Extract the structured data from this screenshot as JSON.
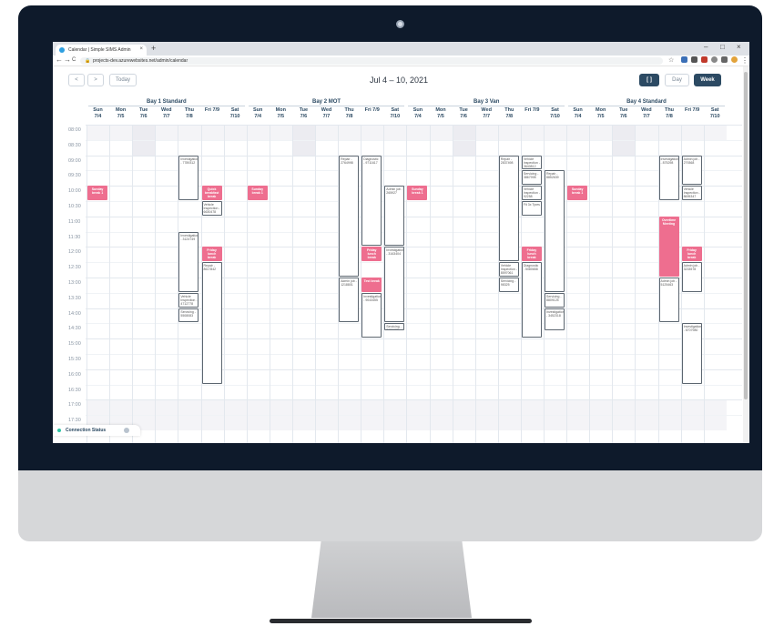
{
  "browser": {
    "tab_title": "Calendar | Simple SIMS Admin",
    "url": "projects-dev.azurewebsites.net/admin/calendar",
    "new_tab": "+",
    "minimize": "–",
    "maximize": "□",
    "close": "×",
    "tab_close": "×",
    "back": "←",
    "forward": "→",
    "reload": "C",
    "star": "☆",
    "menu": "⋮"
  },
  "toolbar": {
    "prev": "<",
    "next": ">",
    "today": "Today",
    "title": "Jul 4 – 10, 2021",
    "fullscreen": "[ ]",
    "day": "Day",
    "week": "Week"
  },
  "bays": [
    "Bay 1 Standard",
    "Bay 2 MOT",
    "Bay 3 Van",
    "Bay 4 Standard"
  ],
  "days": [
    {
      "name": "Sun",
      "date": "7/4"
    },
    {
      "name": "Mon",
      "date": "7/5"
    },
    {
      "name": "Tue",
      "date": "7/6"
    },
    {
      "name": "Wed",
      "date": "7/7"
    },
    {
      "name": "Thu",
      "date": "7/8"
    },
    {
      "name": "Fri 7/9",
      "date": ""
    },
    {
      "name": "Sat",
      "date": "7/10"
    }
  ],
  "times": [
    "08:00",
    "08:30",
    "09:00",
    "09:30",
    "10:00",
    "10:30",
    "11:00",
    "11:30",
    "12:00",
    "12:30",
    "13:00",
    "13:30",
    "14:00",
    "14:30",
    "15:00",
    "15:30",
    "16:00",
    "16:30",
    "17:00",
    "17:30"
  ],
  "events": [
    {
      "bay": 0,
      "day": 0,
      "start": 10.0,
      "end": 10.5,
      "label": "Sunday break 1",
      "pink": true
    },
    {
      "bay": 0,
      "day": 4,
      "start": 9.0,
      "end": 10.5,
      "label": "Investigation - 7789312",
      "pink": false
    },
    {
      "bay": 0,
      "day": 5,
      "start": 10.0,
      "end": 10.5,
      "label": "Quick breakfast break",
      "pink": true
    },
    {
      "bay": 0,
      "day": 5,
      "start": 10.5,
      "end": 11.0,
      "label": "Vehicle Inspection - 6630478",
      "pink": false
    },
    {
      "bay": 0,
      "day": 4,
      "start": 11.5,
      "end": 13.5,
      "label": "Investigation - 3124749",
      "pink": false
    },
    {
      "bay": 0,
      "day": 5,
      "start": 12.0,
      "end": 12.5,
      "label": "Friday lunch break",
      "pink": true
    },
    {
      "bay": 0,
      "day": 5,
      "start": 12.5,
      "end": 16.5,
      "label": "Repair - 8617842",
      "pink": false
    },
    {
      "bay": 0,
      "day": 4,
      "start": 13.5,
      "end": 14.0,
      "label": "Vehicle Inspection - 4712778",
      "pink": false
    },
    {
      "bay": 0,
      "day": 4,
      "start": 14.0,
      "end": 14.5,
      "label": "Servicing - 5508083",
      "pink": false
    },
    {
      "bay": 1,
      "day": 0,
      "start": 10.0,
      "end": 10.5,
      "label": "Sunday break 1",
      "pink": true
    },
    {
      "bay": 1,
      "day": 4,
      "start": 9.0,
      "end": 13.0,
      "label": "Repair - 2764998",
      "pink": false
    },
    {
      "bay": 1,
      "day": 5,
      "start": 9.0,
      "end": 12.0,
      "label": "Diagnostic - 9711617",
      "pink": false
    },
    {
      "bay": 1,
      "day": 6,
      "start": 10.0,
      "end": 12.0,
      "label": "Admin job - 265927",
      "pink": false
    },
    {
      "bay": 1,
      "day": 5,
      "start": 12.0,
      "end": 12.5,
      "label": "Friday lunch break",
      "pink": true
    },
    {
      "bay": 1,
      "day": 6,
      "start": 12.0,
      "end": 14.5,
      "label": "Investigation - 3163404",
      "pink": false
    },
    {
      "bay": 1,
      "day": 4,
      "start": 13.0,
      "end": 14.5,
      "label": "Admin job - 1218801",
      "pink": false
    },
    {
      "bay": 1,
      "day": 5,
      "start": 13.0,
      "end": 13.5,
      "label": "Test break",
      "pink": true
    },
    {
      "bay": 1,
      "day": 5,
      "start": 13.5,
      "end": 15.0,
      "label": "Investigation - 9043455",
      "pink": false
    },
    {
      "bay": 1,
      "day": 6,
      "start": 14.5,
      "end": 14.75,
      "label": "Servicing - 3656935",
      "pink": false
    },
    {
      "bay": 2,
      "day": 0,
      "start": 10.0,
      "end": 10.5,
      "label": "Sunday break 1",
      "pink": true
    },
    {
      "bay": 2,
      "day": 4,
      "start": 9.0,
      "end": 12.5,
      "label": "Repair - 2837498",
      "pink": false
    },
    {
      "bay": 2,
      "day": 5,
      "start": 9.0,
      "end": 9.5,
      "label": "Vehicle Inspection - 3640812",
      "pink": false
    },
    {
      "bay": 2,
      "day": 5,
      "start": 9.5,
      "end": 10.0,
      "label": "Servicing - 3867998",
      "pink": false
    },
    {
      "bay": 2,
      "day": 6,
      "start": 9.5,
      "end": 13.5,
      "label": "Repair - 8852639",
      "pink": false
    },
    {
      "bay": 2,
      "day": 5,
      "start": 10.0,
      "end": 10.5,
      "label": "Vehicle Inspection - 92258",
      "pink": false
    },
    {
      "bay": 2,
      "day": 5,
      "start": 10.5,
      "end": 11.0,
      "label": "Fit 3x Tyres",
      "pink": false
    },
    {
      "bay": 2,
      "day": 5,
      "start": 12.0,
      "end": 12.5,
      "label": "Friday lunch break",
      "pink": true
    },
    {
      "bay": 2,
      "day": 4,
      "start": 12.5,
      "end": 13.0,
      "label": "Vehicle Inspection - 8597061",
      "pink": false
    },
    {
      "bay": 2,
      "day": 5,
      "start": 12.5,
      "end": 15.0,
      "label": "Diagnostic - 5080658",
      "pink": false
    },
    {
      "bay": 2,
      "day": 4,
      "start": 13.0,
      "end": 13.5,
      "label": "Servicing - 98325",
      "pink": false
    },
    {
      "bay": 2,
      "day": 6,
      "start": 13.5,
      "end": 14.0,
      "label": "Servicing - 8809125",
      "pink": false
    },
    {
      "bay": 2,
      "day": 6,
      "start": 14.0,
      "end": 14.75,
      "label": "Investigation - 3452318",
      "pink": false
    },
    {
      "bay": 3,
      "day": 0,
      "start": 10.0,
      "end": 10.5,
      "label": "Sunday break 1",
      "pink": true
    },
    {
      "bay": 3,
      "day": 4,
      "start": 9.0,
      "end": 10.5,
      "label": "Investigation - 875298",
      "pink": false
    },
    {
      "bay": 3,
      "day": 5,
      "start": 9.0,
      "end": 10.0,
      "label": "Admin job - 279368",
      "pink": false
    },
    {
      "bay": 3,
      "day": 5,
      "start": 10.0,
      "end": 10.5,
      "label": "Vehicle Inspection - 8695347",
      "pink": false
    },
    {
      "bay": 3,
      "day": 4,
      "start": 11.0,
      "end": 13.0,
      "label": "Overtime Meeting",
      "pink": true
    },
    {
      "bay": 3,
      "day": 5,
      "start": 12.0,
      "end": 12.5,
      "label": "Friday lunch break",
      "pink": true
    },
    {
      "bay": 3,
      "day": 5,
      "start": 12.5,
      "end": 13.5,
      "label": "Admin job - 3233578",
      "pink": false
    },
    {
      "bay": 3,
      "day": 4,
      "start": 13.0,
      "end": 14.5,
      "label": "Admin job - 5125463",
      "pink": false
    },
    {
      "bay": 3,
      "day": 5,
      "start": 14.5,
      "end": 16.5,
      "label": "Investigation - 6707980",
      "pink": false
    }
  ],
  "connection": {
    "label": "Connection Status"
  },
  "colors": {
    "accent": "#2c4a63",
    "break": "#ee6e8f",
    "teal": "#2ec4a5"
  }
}
